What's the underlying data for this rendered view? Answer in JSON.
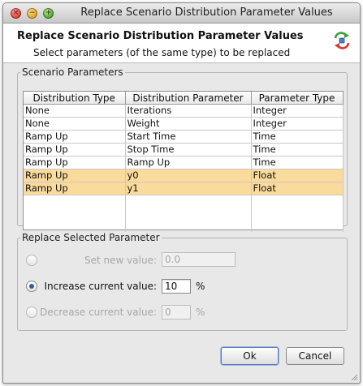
{
  "window": {
    "title": "Replace Scenario Distribution Parameter Values"
  },
  "header": {
    "title": "Replace Scenario Distribution Parameter Values",
    "subtitle": "Select parameters (of the same type) to be replaced",
    "icon": "swap-arrows-icon"
  },
  "scenario_params": {
    "legend": "Scenario Parameters",
    "columns": [
      "Distribution Type",
      "Distribution Parameter",
      "Parameter Type"
    ],
    "rows": [
      {
        "dist_type": "None",
        "param": "Iterations",
        "ptype": "Integer",
        "selected": false
      },
      {
        "dist_type": "None",
        "param": "Weight",
        "ptype": "Integer",
        "selected": false
      },
      {
        "dist_type": "Ramp Up",
        "param": "Start Time",
        "ptype": "Time",
        "selected": false
      },
      {
        "dist_type": "Ramp Up",
        "param": "Stop Time",
        "ptype": "Time",
        "selected": false
      },
      {
        "dist_type": "Ramp Up",
        "param": "Ramp Up",
        "ptype": "Time",
        "selected": false
      },
      {
        "dist_type": "Ramp Up",
        "param": "y0",
        "ptype": "Float",
        "selected": true
      },
      {
        "dist_type": "Ramp Up",
        "param": "y1",
        "ptype": "Float",
        "selected": true
      }
    ]
  },
  "replace": {
    "legend": "Replace Selected Parameter",
    "set_label": "Set new value:",
    "set_value": "0.0",
    "increase_label": "Increase current value:",
    "increase_value": "10",
    "increase_unit": "%",
    "decrease_label": "Decrease current value:",
    "decrease_value": "0",
    "decrease_unit": "%",
    "selected_option": "increase"
  },
  "buttons": {
    "ok": "Ok",
    "cancel": "Cancel"
  },
  "colors": {
    "selection": "#fbdb9b",
    "header_bg": "#ffffff",
    "window_bg": "#e8e8e8"
  }
}
